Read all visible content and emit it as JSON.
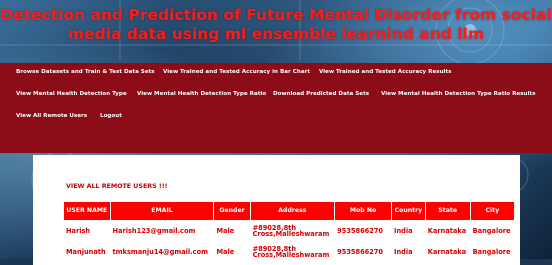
{
  "header": {
    "title_line1": "Detection and Prediction of Future Mental Disorder from social",
    "title_line2": "media data using ml ensemble learnind and llm"
  },
  "nav": {
    "row1": [
      "Browse Datasets and Train & Test Data Sets",
      "View Trained and Tested Accuracy in Bar Chart",
      "View Trained and Tested Accuracy Results"
    ],
    "row2": [
      "View Mental Health Detection Type",
      "View Mental Health Detection Type Ratio",
      "Download Predicted Data Sets",
      "View Mental Health Detection Type Ratio Results"
    ],
    "row3": [
      "View All Remote Users",
      "Logout"
    ]
  },
  "panel": {
    "heading": "VIEW ALL REMOTE USERS !!!"
  },
  "table": {
    "columns": [
      "USER NAME",
      "EMAIL",
      "Gender",
      "Address",
      "Mob No",
      "Country",
      "State",
      "City"
    ],
    "rows": [
      [
        "Harish",
        "Harish123@gmail.com",
        "Male",
        "#89028,8th Cross,Malleshwaram",
        "9535866270",
        "India",
        "Karnataka",
        "Bangalore"
      ],
      [
        "Manjunath",
        "tmksmanju14@gmail.com",
        "Male",
        "#89028,8th Cross,Malleshwaram",
        "9535866270",
        "India",
        "Karnataka",
        "Bangalore"
      ]
    ]
  },
  "colors": {
    "title_red": "#ff1a1a",
    "nav_bg": "#8b0b16",
    "table_header_bg": "#ff0000",
    "text_red": "#d40000"
  }
}
